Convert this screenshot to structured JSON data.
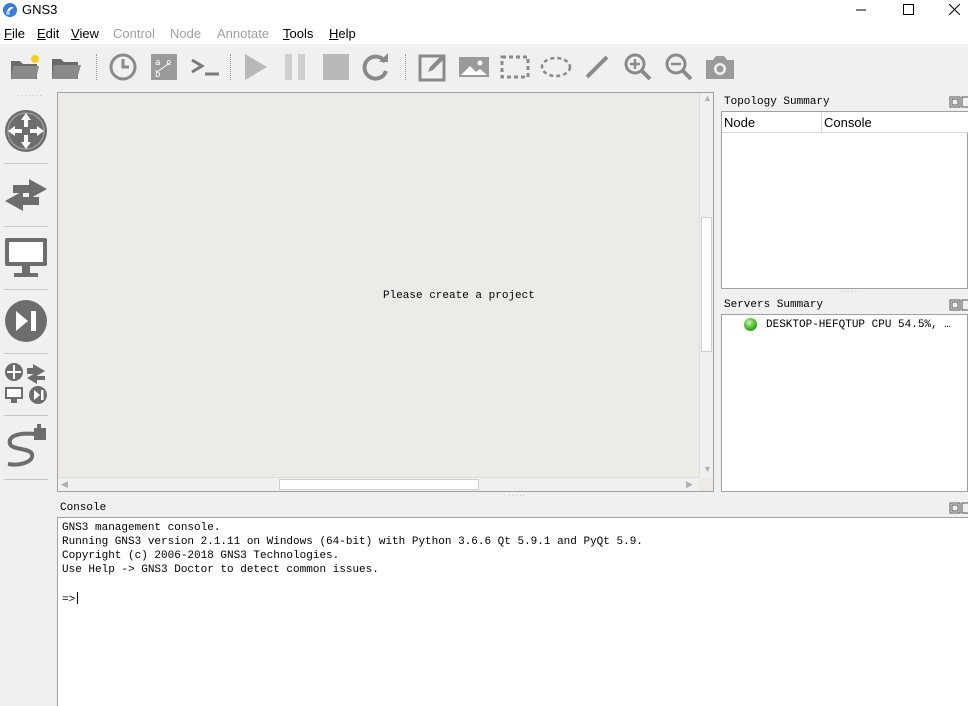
{
  "window": {
    "title": "GNS3",
    "minimize_icon": "minimize-icon",
    "maximize_icon": "maximize-icon",
    "close_icon": "close-icon"
  },
  "menu": {
    "items": [
      {
        "label": "File",
        "mnemonic": "F",
        "enabled": true
      },
      {
        "label": "Edit",
        "mnemonic": "E",
        "enabled": true
      },
      {
        "label": "View",
        "mnemonic": "V",
        "enabled": true
      },
      {
        "label": "Control",
        "enabled": false
      },
      {
        "label": "Node",
        "enabled": false
      },
      {
        "label": "Annotate",
        "enabled": false
      },
      {
        "label": "Tools",
        "mnemonic": "T",
        "enabled": true
      },
      {
        "label": "Help",
        "mnemonic": "H",
        "enabled": true
      }
    ]
  },
  "toolbar": {
    "icons": [
      "new-project-icon",
      "open-project-icon",
      "snapshot-icon",
      "show-interface-labels-icon",
      "console-all-icon",
      "start-all-icon",
      "suspend-all-icon",
      "stop-all-icon",
      "reload-all-icon",
      "add-note-icon",
      "insert-picture-icon",
      "draw-rectangle-icon",
      "draw-ellipse-icon",
      "draw-line-icon",
      "zoom-in-icon",
      "zoom-out-icon",
      "screenshot-icon"
    ]
  },
  "devices": {
    "icons": [
      "routers-icon",
      "switches-icon",
      "end-devices-icon",
      "security-devices-icon",
      "all-devices-icon",
      "add-link-icon"
    ]
  },
  "canvas": {
    "message": "Please create a project"
  },
  "topology_summary": {
    "title": "Topology Summary",
    "columns": [
      "Node",
      "Console"
    ]
  },
  "servers_summary": {
    "title": "Servers Summary",
    "server": "DESKTOP-HEFQTUP CPU 54.5%, …",
    "status_color": "#3eb321"
  },
  "console": {
    "title": "Console",
    "lines": [
      "GNS3 management console.",
      "Running GNS3 version 2.1.11 on Windows (64-bit) with Python 3.6.6 Qt 5.9.1 and PyQt 5.9.",
      "Copyright (c) 2006-2018 GNS3 Technologies.",
      "Use Help -> GNS3 Doctor to detect common issues."
    ],
    "prompt": "=>"
  }
}
